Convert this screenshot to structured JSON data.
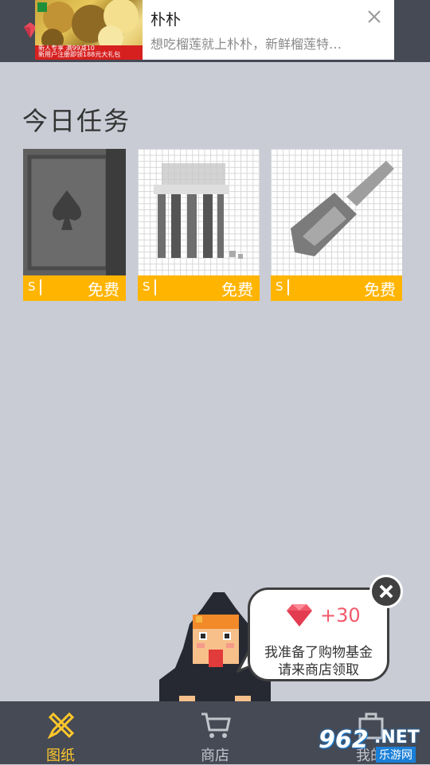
{
  "ad": {
    "title": "朴朴",
    "description": "想吃榴莲就上朴朴，新鲜榴莲特…",
    "image_line1": "新人专享 满99减10",
    "image_line2": "新用户注册即领188元大礼包"
  },
  "section_title": "今日任务",
  "tasks": [
    {
      "icon": "spade-card-icon",
      "currency": "S",
      "price": "免费"
    },
    {
      "icon": "popcorn-icon",
      "currency": "S",
      "price": "免费"
    },
    {
      "icon": "shovel-icon",
      "currency": "S",
      "price": "免费"
    }
  ],
  "bubble": {
    "amount": "+30",
    "message_line1": "我准备了购物基金",
    "message_line2": "请来商店领取"
  },
  "nav": {
    "items": [
      {
        "label": "图纸",
        "icon": "pencil-ruler-icon",
        "active": true
      },
      {
        "label": "商店",
        "icon": "cart-icon",
        "active": false
      },
      {
        "label": "我的",
        "icon": "bag-icon",
        "active": false
      }
    ]
  },
  "watermark": {
    "number": "962",
    "suffix": ".NET",
    "site": "乐游网"
  },
  "colors": {
    "background": "#c9ccd5",
    "topbar": "#454a55",
    "task_bar": "#ffb400",
    "nav_active": "#ffc72a",
    "nav_inactive": "#c3c5cc",
    "gem": "#f05a6a"
  }
}
